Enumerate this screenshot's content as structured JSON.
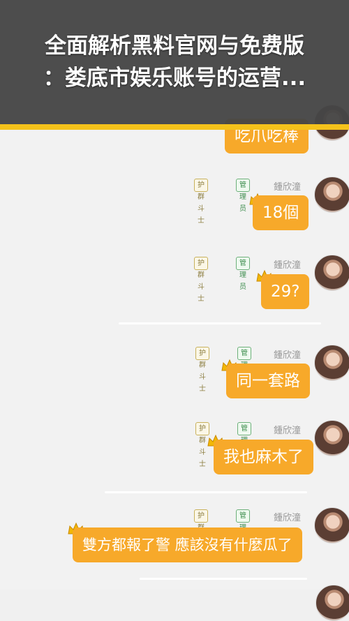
{
  "banner": {
    "line1": "全面解析黑料官网与免费版",
    "line2": "：娄底市娱乐账号的运营..."
  },
  "colors": {
    "bubble": "#f7a92a",
    "banner_bg": "#464646",
    "banner_stripe": "#f5c21b",
    "page_bg": "#f2f2f2"
  },
  "badges": {
    "fan": "护群斗士",
    "admin": "管理员"
  },
  "username": "鍾欣潼",
  "messages": [
    {
      "text": "吃爪吃棒"
    },
    {
      "text": "18個"
    },
    {
      "text": "29?"
    },
    {
      "text": "同一套路"
    },
    {
      "text": "我也麻木了"
    },
    {
      "text": "雙方都報了警 應該沒有什麼瓜了"
    }
  ]
}
